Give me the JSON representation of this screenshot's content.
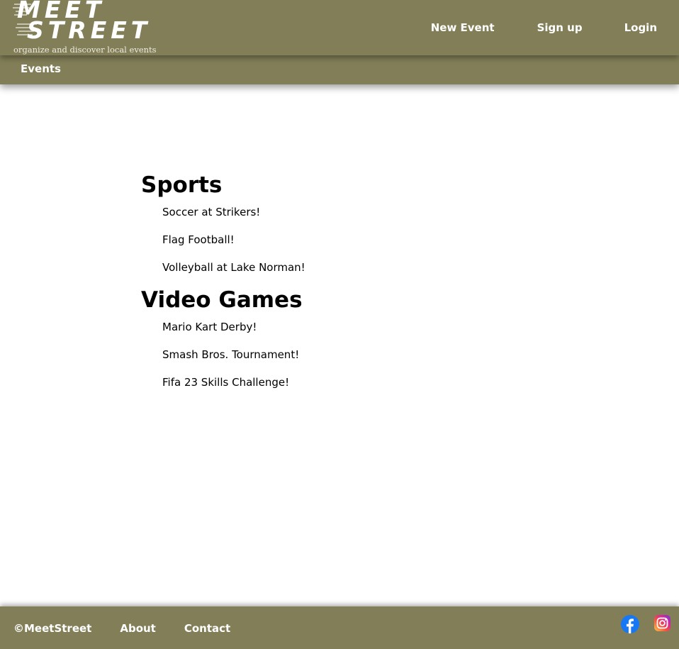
{
  "header": {
    "logo": {
      "line1": "MEET",
      "line2": "STREET",
      "tagline": "organize and discover local events"
    },
    "nav": [
      {
        "label": "New Event"
      },
      {
        "label": "Sign up"
      },
      {
        "label": "Login"
      }
    ]
  },
  "subnav": {
    "events_label": "Events"
  },
  "categories": [
    {
      "title": "Sports",
      "events": [
        "Soccer at Strikers!",
        "Flag Football!",
        "Volleyball at Lake Norman!"
      ]
    },
    {
      "title": "Video Games",
      "events": [
        "Mario Kart Derby!",
        "Smash Bros. Tournament!",
        "Fifa 23 Skills Challenge!"
      ]
    }
  ],
  "footer": {
    "copyright": "©MeetStreet",
    "links": [
      {
        "label": "About"
      },
      {
        "label": "Contact"
      }
    ],
    "social": [
      {
        "icon": "facebook-icon",
        "color": "#1877f2"
      },
      {
        "icon": "instagram-icon",
        "color": "#d6249f"
      }
    ]
  },
  "colors": {
    "bar": "#827f58",
    "text": "#000000",
    "bar_text": "#ffffff"
  }
}
